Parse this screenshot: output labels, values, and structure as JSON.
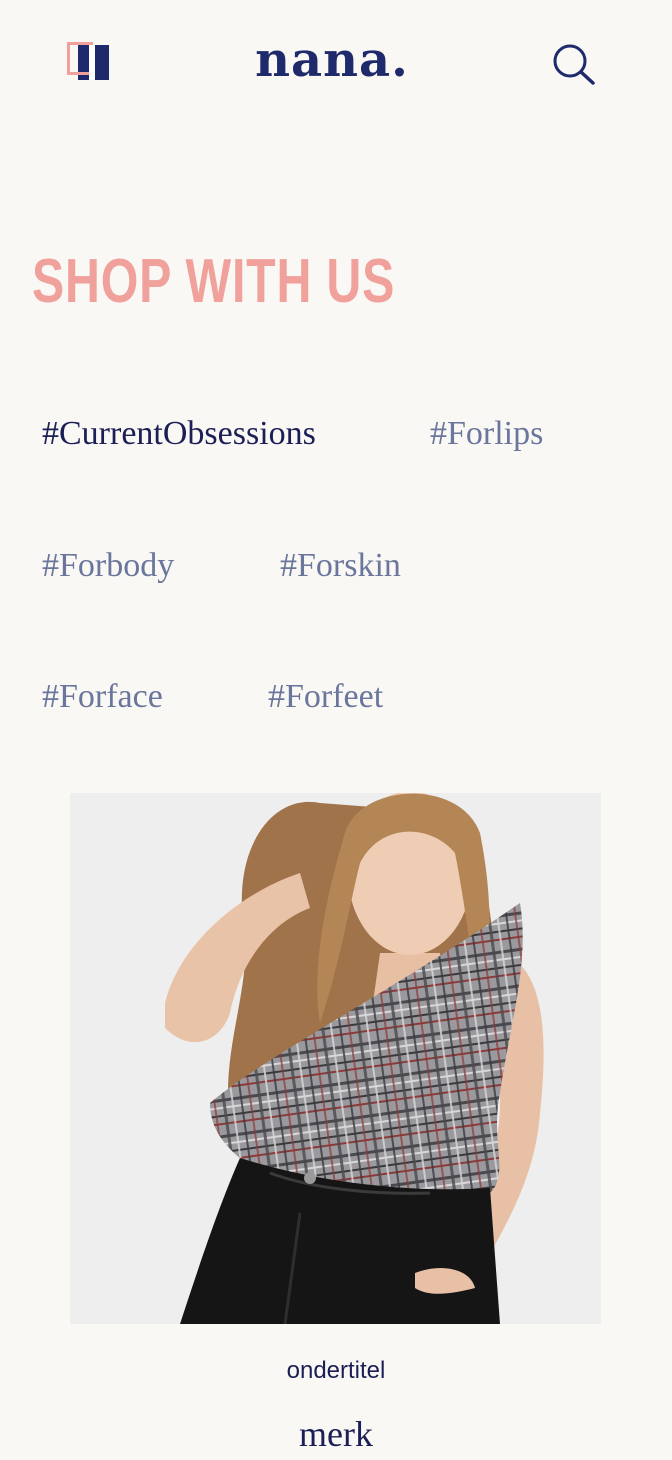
{
  "header": {
    "logo_text": "nana.",
    "menu_icon": "menu-icon",
    "search_icon": "search-icon"
  },
  "section": {
    "title": "SHOP WITH US"
  },
  "tags": [
    {
      "label": "#CurrentObsessions",
      "active": true
    },
    {
      "label": "#Forlips",
      "active": false
    },
    {
      "label": "#Forbody",
      "active": false
    },
    {
      "label": "#Forskin",
      "active": false
    },
    {
      "label": "#Forface",
      "active": false
    },
    {
      "label": "#Forfeet",
      "active": false
    }
  ],
  "product": {
    "subtitle": "ondertitel",
    "brand": "merk"
  },
  "colors": {
    "background": "#faf8f4",
    "navy": "#1e2a6b",
    "pink": "#f0a19c",
    "tag_inactive": "#6a769c"
  }
}
